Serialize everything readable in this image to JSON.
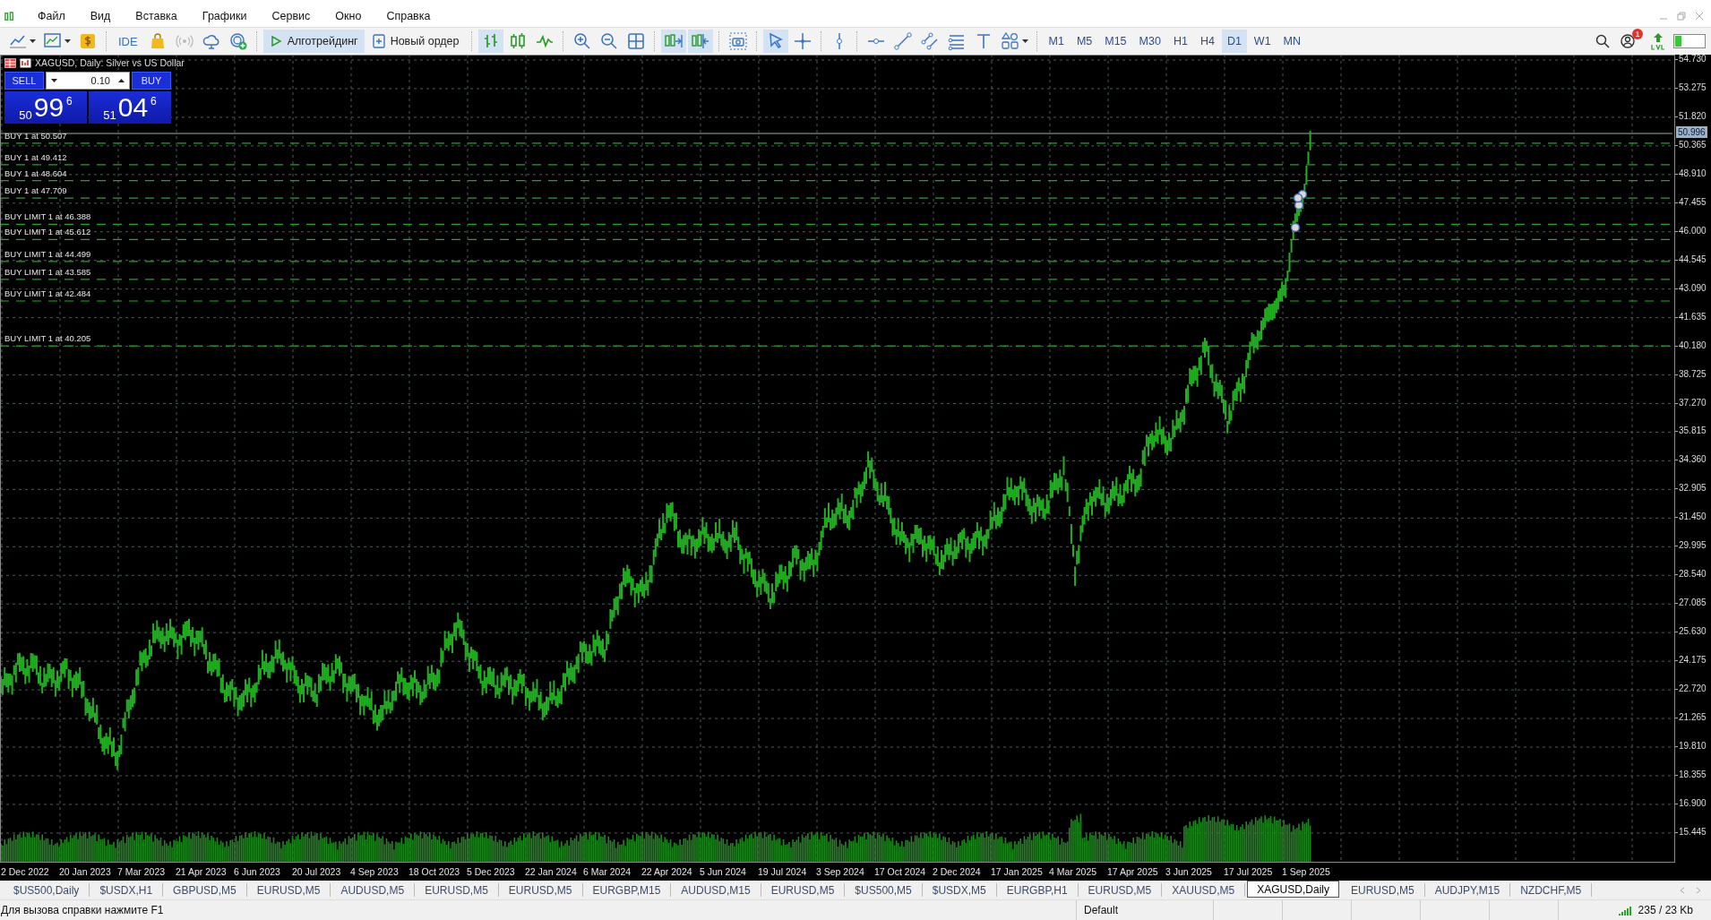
{
  "menu": [
    "Файл",
    "Вид",
    "Вставка",
    "Графики",
    "Сервис",
    "Окно",
    "Справка"
  ],
  "toolbar": {
    "ide": "IDE",
    "algo_trading": {
      "label": "Алготрейдинг",
      "on": true
    },
    "new_order": "Новый ордер",
    "notifications": "1",
    "timeframes": [
      {
        "label": "M1",
        "selected": false
      },
      {
        "label": "M5",
        "selected": false
      },
      {
        "label": "M15",
        "selected": false
      },
      {
        "label": "M30",
        "selected": false
      },
      {
        "label": "H1",
        "selected": false
      },
      {
        "label": "H4",
        "selected": false
      },
      {
        "label": "D1",
        "selected": true
      },
      {
        "label": "W1",
        "selected": false
      },
      {
        "label": "MN",
        "selected": false
      }
    ]
  },
  "chart": {
    "header": "XAGUSD, Daily:  Silver vs US Dollar",
    "one_click": {
      "sell_label": "SELL",
      "buy_label": "BUY",
      "volume": "0.10",
      "sell_price": {
        "big": "50",
        "main": "99",
        "sup": "6"
      },
      "buy_price": {
        "big": "51",
        "main": "04",
        "sup": "6"
      }
    },
    "orders": [
      {
        "label": "BUY 1 at 50.507"
      },
      {
        "label": "BUY 1 at 49.412"
      },
      {
        "label": "BUY 1 at 48.604"
      },
      {
        "label": "BUY 1 at 47.709"
      },
      {
        "label": "BUY LIMIT 1 at 46.388"
      },
      {
        "label": "BUY LIMIT 1 at 45.612"
      },
      {
        "label": "BUY LIMIT 1 at 44.499"
      },
      {
        "label": "BUY LIMIT 1 at 43.585"
      },
      {
        "label": "BUY LIMIT 1 at 42.484"
      },
      {
        "label": "BUY LIMIT 1 at 40.205"
      }
    ],
    "current_price": "50.996",
    "price_axis": [
      "54.730",
      "53.275",
      "51.820",
      "50.365",
      "48.910",
      "47.455",
      "46.000",
      "44.545",
      "43.090",
      "41.635",
      "40.180",
      "38.725",
      "37.270",
      "35.815",
      "34.360",
      "32.905",
      "31.450",
      "29.995",
      "28.540",
      "27.085",
      "25.630",
      "24.175",
      "22.720",
      "21.265",
      "19.810",
      "18.355",
      "16.900",
      "15.445"
    ],
    "date_axis": [
      "2 Dec 2022",
      "20 Jan 2023",
      "7 Mar 2023",
      "21 Apr 2023",
      "6 Jun 2023",
      "20 Jul 2023",
      "4 Sep 2023",
      "18 Oct 2023",
      "5 Dec 2023",
      "22 Jan 2024",
      "6 Mar 2024",
      "22 Apr 2024",
      "5 Jun 2024",
      "19 Jul 2024",
      "3 Sep 2024",
      "17 Oct 2024",
      "2 Dec 2024",
      "17 Jan 2025",
      "4 Mar 2025",
      "17 Apr 2025",
      "3 Jun 2025",
      "17 Jul 2025",
      "1 Sep 2025"
    ]
  },
  "tabs": [
    {
      "label": "$US500,Daily",
      "selected": false
    },
    {
      "label": "$USDX,H1",
      "selected": false
    },
    {
      "label": "GBPUSD,M5",
      "selected": false
    },
    {
      "label": "EURUSD,M5",
      "selected": false
    },
    {
      "label": "AUDUSD,M5",
      "selected": false
    },
    {
      "label": "EURUSD,M5",
      "selected": false
    },
    {
      "label": "EURUSD,M5",
      "selected": false
    },
    {
      "label": "EURGBP,M15",
      "selected": false
    },
    {
      "label": "AUDUSD,M15",
      "selected": false
    },
    {
      "label": "EURUSD,M5",
      "selected": false
    },
    {
      "label": "$US500,M5",
      "selected": false
    },
    {
      "label": "$USDX,M5",
      "selected": false
    },
    {
      "label": "EURGBP,H1",
      "selected": false
    },
    {
      "label": "EURUSD,M5",
      "selected": false
    },
    {
      "label": "XAUUSD,M5",
      "selected": false
    },
    {
      "label": "XAGUSD,Daily",
      "selected": true
    },
    {
      "label": "EURUSD,M5",
      "selected": false
    },
    {
      "label": "AUDJPY,M15",
      "selected": false
    },
    {
      "label": "NZDCHF,M5",
      "selected": false
    }
  ],
  "status_bar": {
    "hint": "Для вызова справки нажмите F1",
    "profile": "Default",
    "traffic": "235 / 23 Kb"
  }
}
